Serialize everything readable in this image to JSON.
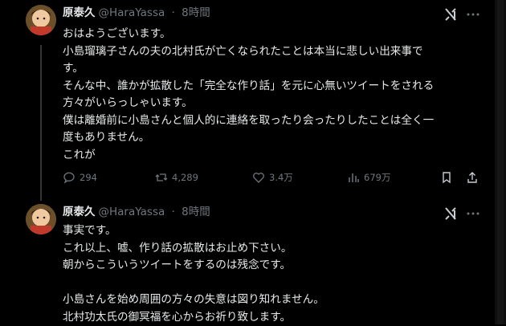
{
  "tweet1": {
    "author_name": "原泰久",
    "author_handle": "@HaraYassa",
    "separator": "·",
    "time": "8時間",
    "lines": [
      "おはようございます。",
      "小島瑠璃子さんの夫の北村氏が亡くなられたことは本当に悲しい出来事で",
      "す。",
      "そんな中、誰かが拡散した「完全な作り話」を元に心無いツイートをされる",
      "方々がいらっしゃいます。",
      "僕は離婚前に小島さんと個人的に連絡を取ったり会ったりしたことは全く一",
      "度もありません。",
      "これが"
    ],
    "stats": {
      "replies": "294",
      "retweets": "4,289",
      "likes": "3.4万",
      "views": "679万"
    }
  },
  "tweet2": {
    "author_name": "原泰久",
    "author_handle": "@HaraYassa",
    "separator": "·",
    "time": "8時間",
    "lines": [
      "事実です。",
      "これ以上、嘘、作り話の拡散はお止め下さい。",
      "朝からこういうツイートをするのは残念です。",
      "",
      "小島さんを始め周囲の方々の失意は図り知れません。",
      "北村功太氏の御冥福を心からお祈り致します。"
    ]
  },
  "icons": [
    "grok-icon",
    "more-icon",
    "reply-icon",
    "retweet-icon",
    "like-icon",
    "views-icon",
    "bookmark-icon",
    "share-icon"
  ],
  "colors": {
    "background": "#000000",
    "text": "#e7e9ea",
    "muted": "#71767b",
    "thread_line": "#333639"
  }
}
